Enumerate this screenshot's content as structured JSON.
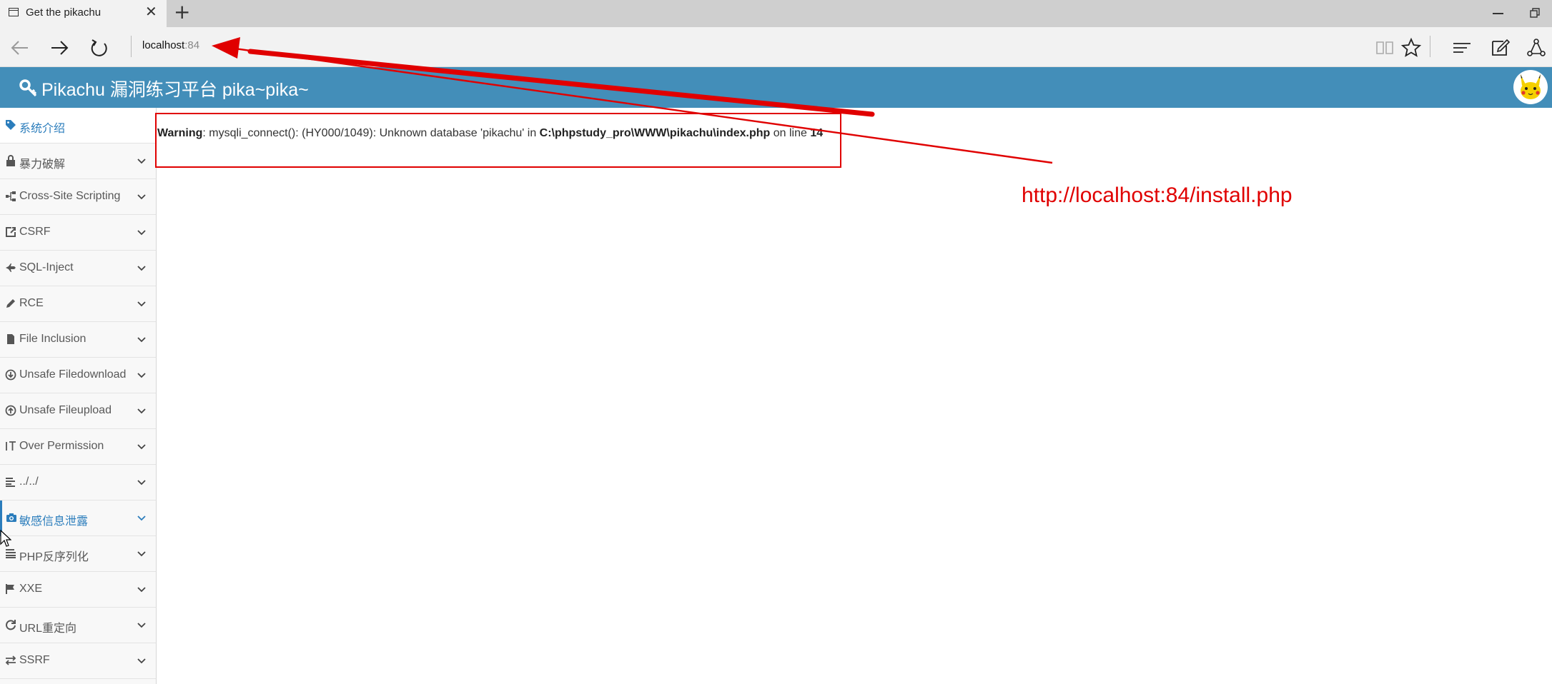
{
  "browser": {
    "tab_title": "Get the pikachu",
    "address_host": "localhost",
    "address_port": ":84"
  },
  "site": {
    "title": "Pikachu 漏洞练习平台 pika~pika~"
  },
  "sidebar": {
    "items": [
      {
        "label": "系统介绍",
        "icon": "tag-icon"
      },
      {
        "label": "暴力破解",
        "icon": "lock-icon"
      },
      {
        "label": "Cross-Site Scripting",
        "icon": "sitemap-icon"
      },
      {
        "label": "CSRF",
        "icon": "share-square-icon"
      },
      {
        "label": "SQL-Inject",
        "icon": "fighter-jet-icon"
      },
      {
        "label": "RCE",
        "icon": "pencil-icon"
      },
      {
        "label": "File Inclusion",
        "icon": "file-icon"
      },
      {
        "label": "Unsafe Filedownload",
        "icon": "download-circle-icon"
      },
      {
        "label": "Unsafe Fileupload",
        "icon": "upload-circle-icon"
      },
      {
        "label": "Over Permission",
        "icon": "text-height-icon"
      },
      {
        "label": "../../",
        "icon": "align-left-icon"
      },
      {
        "label": "敏感信息泄露",
        "icon": "camera-icon"
      },
      {
        "label": "PHP反序列化",
        "icon": "align-justify-icon"
      },
      {
        "label": "XXE",
        "icon": "flag-icon"
      },
      {
        "label": "URL重定向",
        "icon": "refresh-icon"
      },
      {
        "label": "SSRF",
        "icon": "exchange-icon"
      }
    ]
  },
  "content": {
    "warning_label": "Warning",
    "warning_msg": ": mysqli_connect(): (HY000/1049): Unknown database 'pikachu' in ",
    "warning_path": "C:\\phpstudy_pro\\WWW\\pikachu\\index.php",
    "warning_online": " on line ",
    "warning_line": "14"
  },
  "annotation": {
    "url": "http://localhost:84/install.php"
  },
  "colors": {
    "header_blue": "#438eb9",
    "active_blue": "#2b7dbc",
    "annotation_red": "#e00000"
  }
}
